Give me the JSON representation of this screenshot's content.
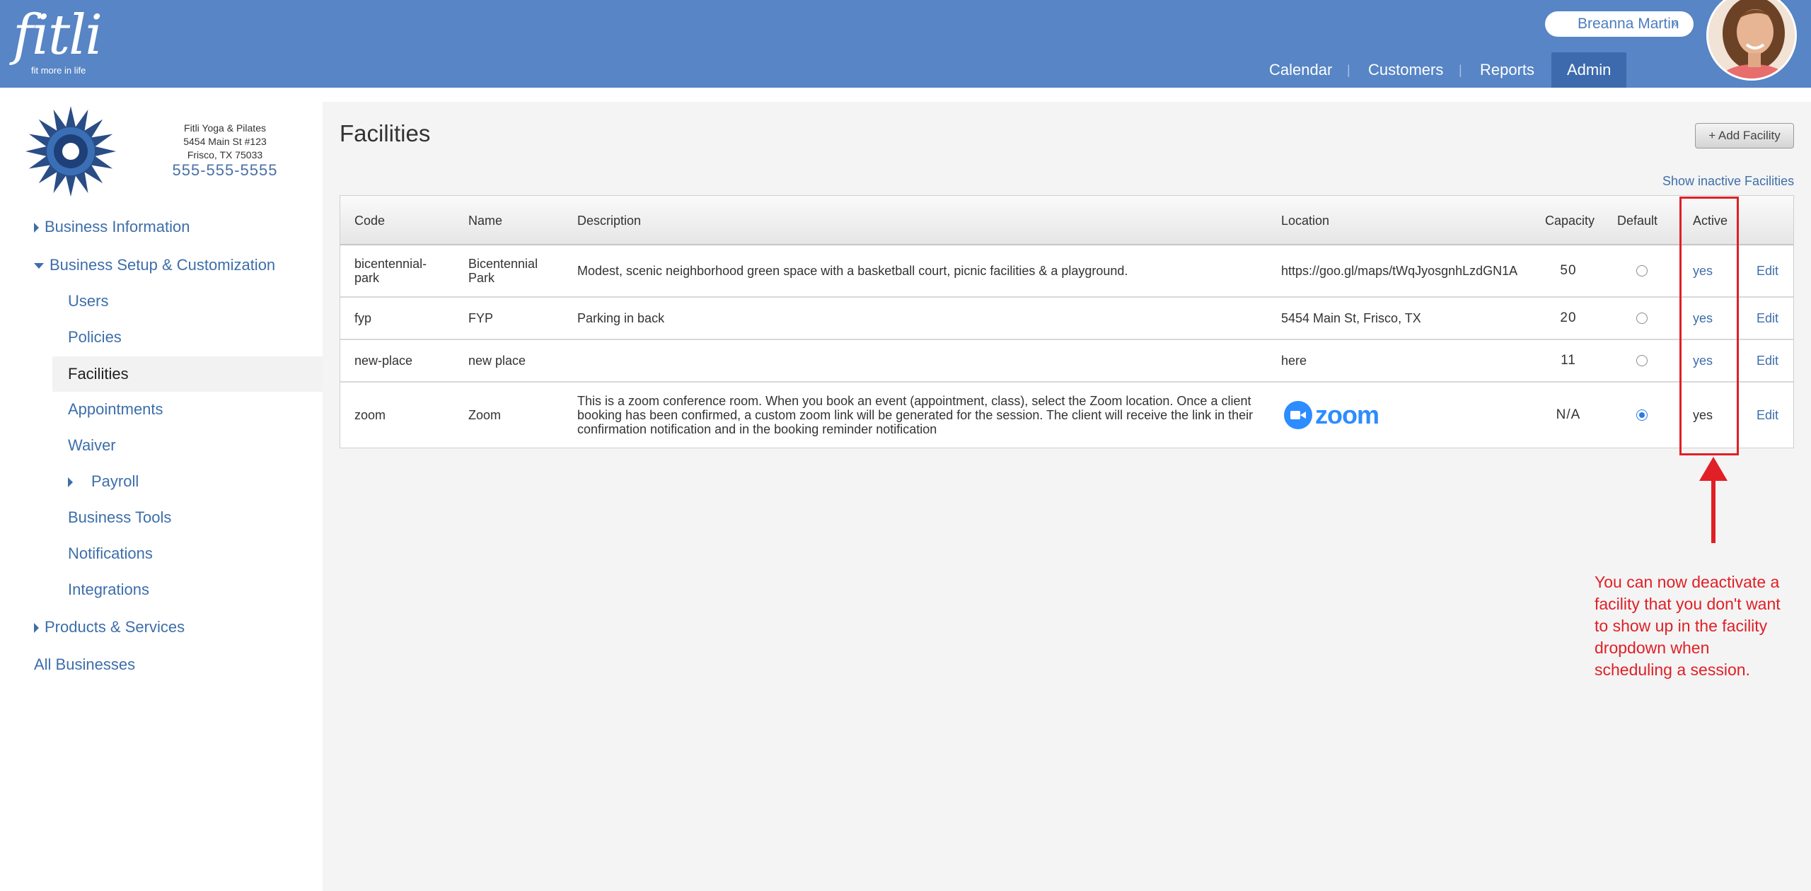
{
  "header": {
    "logo_word": "fitli",
    "logo_tagline": "fit more in life",
    "user_name": "Breanna Martin",
    "user_chevron": "»",
    "nav": [
      "Calendar",
      "Customers",
      "Reports",
      "Admin"
    ],
    "nav_active": "Admin"
  },
  "business": {
    "name": "Fitli Yoga & Pilates",
    "address1": "5454 Main St #123",
    "address2": "Frisco, TX 75033",
    "phone": "555-555-5555"
  },
  "sidebar": {
    "business_information": "Business Information",
    "business_setup": "Business Setup & Customization",
    "users": "Users",
    "policies": "Policies",
    "facilities": "Facilities",
    "appointments": "Appointments",
    "waiver": "Waiver",
    "payroll": "Payroll",
    "business_tools": "Business Tools",
    "notifications": "Notifications",
    "integrations": "Integrations",
    "products_services": "Products & Services",
    "all_businesses": "All Businesses"
  },
  "main": {
    "title": "Facilities",
    "add_button": "+ Add Facility",
    "show_inactive": "Show inactive Facilities",
    "columns": {
      "code": "Code",
      "name": "Name",
      "description": "Description",
      "location": "Location",
      "capacity": "Capacity",
      "default": "Default",
      "active": "Active"
    },
    "rows": [
      {
        "code": "bicentennial-park",
        "name": "Bicentennial Park",
        "description": "Modest, scenic neighborhood green space with a basketball court, picnic facilities & a playground.",
        "location": "https://goo.gl/maps/tWqJyosgnhLzdGN1A",
        "capacity": "50",
        "default": false,
        "active": "yes",
        "edit": "Edit"
      },
      {
        "code": "fyp",
        "name": "FYP",
        "description": "Parking in back",
        "location": "5454 Main St, Frisco, TX",
        "capacity": "20",
        "default": false,
        "active": "yes",
        "edit": "Edit"
      },
      {
        "code": "new-place",
        "name": "new place",
        "description": "",
        "location": "here",
        "capacity": "11",
        "default": false,
        "active": "yes",
        "edit": "Edit"
      },
      {
        "code": "zoom",
        "name": "Zoom",
        "description": "This is a zoom conference room. When you book an event (appointment, class), select the Zoom location. Once a client booking has been confirmed, a custom zoom link will be generated for the session. The client will receive the link in their confirmation notification and in the booking reminder notification",
        "location_logo": "zoom",
        "capacity": "N/A",
        "default": true,
        "active": "yes",
        "edit": "Edit"
      }
    ]
  },
  "annotation": {
    "text": "You can now deactivate a facility that you don't want to show up in the facility dropdown when scheduling a session.",
    "color": "#e01f26"
  },
  "colors": {
    "header": "#5785c5",
    "link": "#3d6eaa",
    "zoom": "#2d8cff"
  }
}
